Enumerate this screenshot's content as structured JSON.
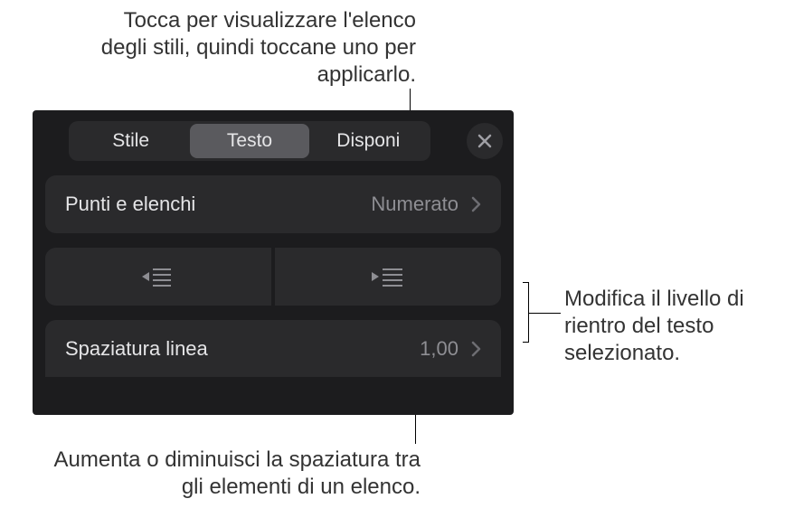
{
  "annotations": {
    "top": "Tocca per visualizzare l'elenco degli stili, quindi toccane uno per applicarlo.",
    "right": "Modifica il livello di rientro del testo selezionato.",
    "bottom": "Aumenta o diminuisci la spaziatura tra gli elementi di un elenco."
  },
  "toolbar": {
    "tabs": [
      {
        "label": "Stile"
      },
      {
        "label": "Testo"
      },
      {
        "label": "Disponi"
      }
    ],
    "active_index": 1
  },
  "rows": {
    "bullets": {
      "label": "Punti e elenchi",
      "value": "Numerato"
    },
    "line_spacing": {
      "label": "Spaziatura linea",
      "value": "1,00"
    }
  },
  "icons": {
    "close": "close-icon",
    "outdent": "outdent-icon",
    "indent": "indent-icon",
    "chevron": "chevron-right-icon"
  }
}
